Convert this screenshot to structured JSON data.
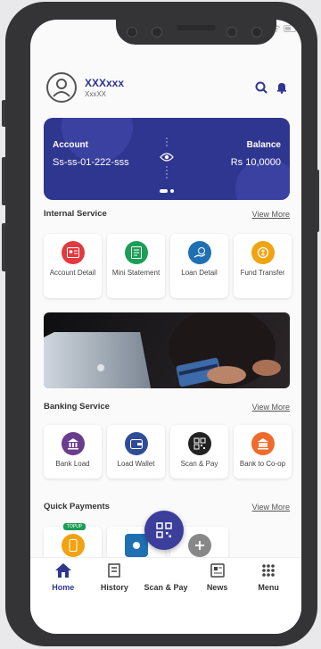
{
  "user": {
    "name": "XXXxxx",
    "sub": "XxxXX"
  },
  "card": {
    "account_label": "Account",
    "account_value": "Ss-ss-01-222-sss",
    "balance_label": "Balance",
    "balance_value": "Rs 10,0000"
  },
  "internal": {
    "title": "Internal Service",
    "view_more": "View More",
    "items": [
      {
        "label": "Account Detail",
        "icon": "account-card-icon",
        "color": "#e23a3f"
      },
      {
        "label": "Mini Statement",
        "icon": "statement-icon",
        "color": "#1b9e57"
      },
      {
        "label": "Loan Detail",
        "icon": "loan-hand-icon",
        "color": "#1f6fb3"
      },
      {
        "label": "Fund Transfer",
        "icon": "coin-transfer-icon",
        "color": "#f2a312"
      }
    ]
  },
  "banking": {
    "title": "Banking Service",
    "view_more": "View More",
    "items": [
      {
        "label": "Bank Load",
        "icon": "bank-icon",
        "color": "#6a3d8c"
      },
      {
        "label": "Load Wallet",
        "icon": "wallet-icon",
        "color": "#2f4c96"
      },
      {
        "label": "Scan & Pay",
        "icon": "qr-icon",
        "color": "#222222"
      },
      {
        "label": "Bank to Co-op",
        "icon": "bank-transfer-icon",
        "color": "#ee6b2c"
      }
    ]
  },
  "quick": {
    "title": "Quick Payments",
    "view_more": "View More",
    "badge": "TOPUP"
  },
  "nav": {
    "items": [
      {
        "label": "Home",
        "icon": "home-icon"
      },
      {
        "label": "History",
        "icon": "history-icon"
      },
      {
        "label": "Scan & Pay",
        "icon": "qr-scan-icon"
      },
      {
        "label": "News",
        "icon": "news-icon"
      },
      {
        "label": "Menu",
        "icon": "menu-grid-icon"
      }
    ]
  },
  "colors": {
    "primary": "#2f368f",
    "frame": "#343436"
  }
}
